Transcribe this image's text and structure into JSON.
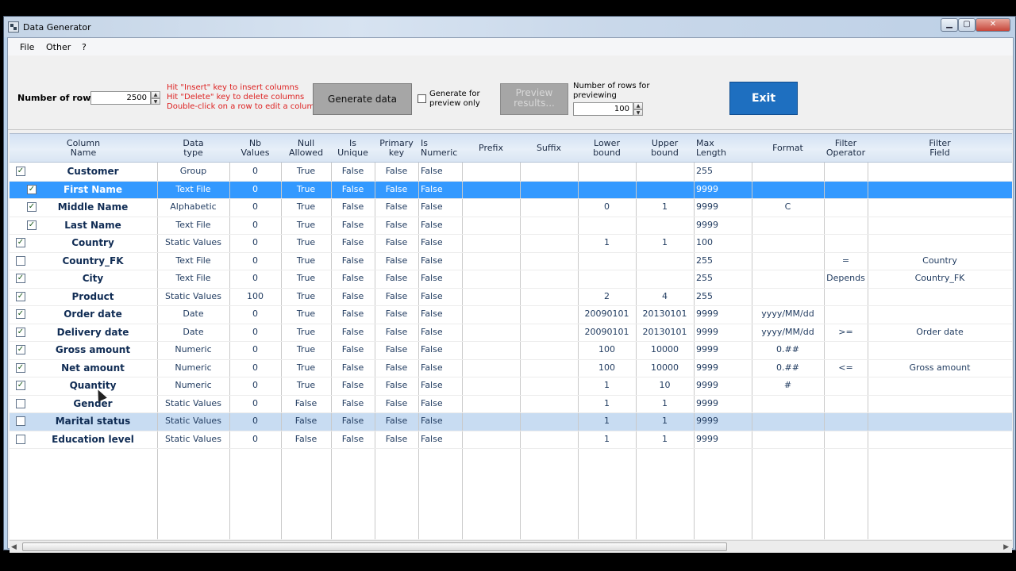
{
  "window": {
    "title": "Data Generator"
  },
  "window_controls": {
    "minimize": "▁",
    "maximize": "▢",
    "close": "✕"
  },
  "menu": {
    "items": [
      "File",
      "Other",
      "?"
    ]
  },
  "toolbar": {
    "rows_label": "Number of rows",
    "rows_value": "2500",
    "hint_insert": "Hit \"Insert\" key to insert columns",
    "hint_delete": "Hit \"Delete\" key to delete columns",
    "hint_edit": "Double-click on a row to edit a column",
    "generate_label": "Generate data",
    "preview_only_label": "Generate for preview only",
    "preview_label": "Preview results...",
    "preview_rows_label": "Number of rows for previewing",
    "preview_rows_value": "100",
    "exit_label": "Exit"
  },
  "colors": {
    "accent": "#1e6fc0",
    "selection": "#3399ff",
    "selection_light": "#c8dcf2",
    "hint_text": "#dd2222"
  },
  "grid": {
    "columns": [
      "Column\nName",
      "Data\ntype",
      "Nb\nValues",
      "Null\nAllowed",
      "Is\nUnique",
      "Primary\nkey",
      "Is\nNumeric",
      "Prefix",
      "Suffix",
      "Lower\nbound",
      "Upper\nbound",
      "Max\nLength",
      "Format",
      "Filter\nOperator",
      "Filter\nField"
    ],
    "rows": [
      {
        "checked": true,
        "child": false,
        "name": "Customer",
        "type": "Group",
        "nb": "0",
        "null": "True",
        "unique": "False",
        "pk": "False",
        "numeric": "False",
        "prefix": "",
        "suffix": "",
        "lower": "",
        "upper": "",
        "maxlen": "255",
        "format": "",
        "fop": "",
        "ffield": ""
      },
      {
        "checked": true,
        "child": true,
        "name": "First Name",
        "type": "Text File",
        "nb": "0",
        "null": "True",
        "unique": "False",
        "pk": "False",
        "numeric": "False",
        "prefix": "",
        "suffix": "",
        "lower": "",
        "upper": "",
        "maxlen": "9999",
        "format": "",
        "fop": "",
        "ffield": ""
      },
      {
        "checked": true,
        "child": true,
        "name": "Middle Name",
        "type": "Alphabetic",
        "nb": "0",
        "null": "True",
        "unique": "False",
        "pk": "False",
        "numeric": "False",
        "prefix": "",
        "suffix": "",
        "lower": "0",
        "upper": "1",
        "maxlen": "9999",
        "format": "C",
        "fop": "",
        "ffield": ""
      },
      {
        "checked": true,
        "child": true,
        "name": "Last Name",
        "type": "Text File",
        "nb": "0",
        "null": "True",
        "unique": "False",
        "pk": "False",
        "numeric": "False",
        "prefix": "",
        "suffix": "",
        "lower": "",
        "upper": "",
        "maxlen": "9999",
        "format": "",
        "fop": "",
        "ffield": ""
      },
      {
        "checked": true,
        "child": false,
        "name": "Country",
        "type": "Static Values",
        "nb": "0",
        "null": "True",
        "unique": "False",
        "pk": "False",
        "numeric": "False",
        "prefix": "",
        "suffix": "",
        "lower": "1",
        "upper": "1",
        "maxlen": "100",
        "format": "",
        "fop": "",
        "ffield": ""
      },
      {
        "checked": false,
        "child": false,
        "name": "Country_FK",
        "type": "Text File",
        "nb": "0",
        "null": "True",
        "unique": "False",
        "pk": "False",
        "numeric": "False",
        "prefix": "",
        "suffix": "",
        "lower": "",
        "upper": "",
        "maxlen": "255",
        "format": "",
        "fop": "=",
        "ffield": "Country"
      },
      {
        "checked": true,
        "child": false,
        "name": "City",
        "type": "Text File",
        "nb": "0",
        "null": "True",
        "unique": "False",
        "pk": "False",
        "numeric": "False",
        "prefix": "",
        "suffix": "",
        "lower": "",
        "upper": "",
        "maxlen": "255",
        "format": "",
        "fop": "Depends",
        "ffield": "Country_FK"
      },
      {
        "checked": true,
        "child": false,
        "name": "Product",
        "type": "Static Values",
        "nb": "100",
        "null": "True",
        "unique": "False",
        "pk": "False",
        "numeric": "False",
        "prefix": "",
        "suffix": "",
        "lower": "2",
        "upper": "4",
        "maxlen": "255",
        "format": "",
        "fop": "",
        "ffield": ""
      },
      {
        "checked": true,
        "child": false,
        "name": "Order date",
        "type": "Date",
        "nb": "0",
        "null": "True",
        "unique": "False",
        "pk": "False",
        "numeric": "False",
        "prefix": "",
        "suffix": "",
        "lower": "20090101",
        "upper": "20130101",
        "maxlen": "9999",
        "format": "yyyy/MM/dd",
        "fop": "",
        "ffield": ""
      },
      {
        "checked": true,
        "child": false,
        "name": "Delivery date",
        "type": "Date",
        "nb": "0",
        "null": "True",
        "unique": "False",
        "pk": "False",
        "numeric": "False",
        "prefix": "",
        "suffix": "",
        "lower": "20090101",
        "upper": "20130101",
        "maxlen": "9999",
        "format": "yyyy/MM/dd",
        "fop": ">=",
        "ffield": "Order date"
      },
      {
        "checked": true,
        "child": false,
        "name": "Gross amount",
        "type": "Numeric",
        "nb": "0",
        "null": "True",
        "unique": "False",
        "pk": "False",
        "numeric": "False",
        "prefix": "",
        "suffix": "",
        "lower": "100",
        "upper": "10000",
        "maxlen": "9999",
        "format": "0.##",
        "fop": "",
        "ffield": ""
      },
      {
        "checked": true,
        "child": false,
        "name": "Net amount",
        "type": "Numeric",
        "nb": "0",
        "null": "True",
        "unique": "False",
        "pk": "False",
        "numeric": "False",
        "prefix": "",
        "suffix": "",
        "lower": "100",
        "upper": "10000",
        "maxlen": "9999",
        "format": "0.##",
        "fop": "<=",
        "ffield": "Gross amount"
      },
      {
        "checked": true,
        "child": false,
        "name": "Quantity",
        "type": "Numeric",
        "nb": "0",
        "null": "True",
        "unique": "False",
        "pk": "False",
        "numeric": "False",
        "prefix": "",
        "suffix": "",
        "lower": "1",
        "upper": "10",
        "maxlen": "9999",
        "format": "#",
        "fop": "",
        "ffield": ""
      },
      {
        "checked": false,
        "child": false,
        "name": "Gender",
        "type": "Static Values",
        "nb": "0",
        "null": "False",
        "unique": "False",
        "pk": "False",
        "numeric": "False",
        "prefix": "",
        "suffix": "",
        "lower": "1",
        "upper": "1",
        "maxlen": "9999",
        "format": "",
        "fop": "",
        "ffield": ""
      },
      {
        "checked": false,
        "child": false,
        "name": "Marital status",
        "type": "Static Values",
        "nb": "0",
        "null": "False",
        "unique": "False",
        "pk": "False",
        "numeric": "False",
        "prefix": "",
        "suffix": "",
        "lower": "1",
        "upper": "1",
        "maxlen": "9999",
        "format": "",
        "fop": "",
        "ffield": ""
      },
      {
        "checked": false,
        "child": false,
        "name": "Education level",
        "type": "Static Values",
        "nb": "0",
        "null": "False",
        "unique": "False",
        "pk": "False",
        "numeric": "False",
        "prefix": "",
        "suffix": "",
        "lower": "1",
        "upper": "1",
        "maxlen": "9999",
        "format": "",
        "fop": "",
        "ffield": ""
      }
    ],
    "selected_row": 1,
    "hover_row": 14
  },
  "scrollbar": {
    "left_arrow": "◀",
    "right_arrow": "▶"
  }
}
